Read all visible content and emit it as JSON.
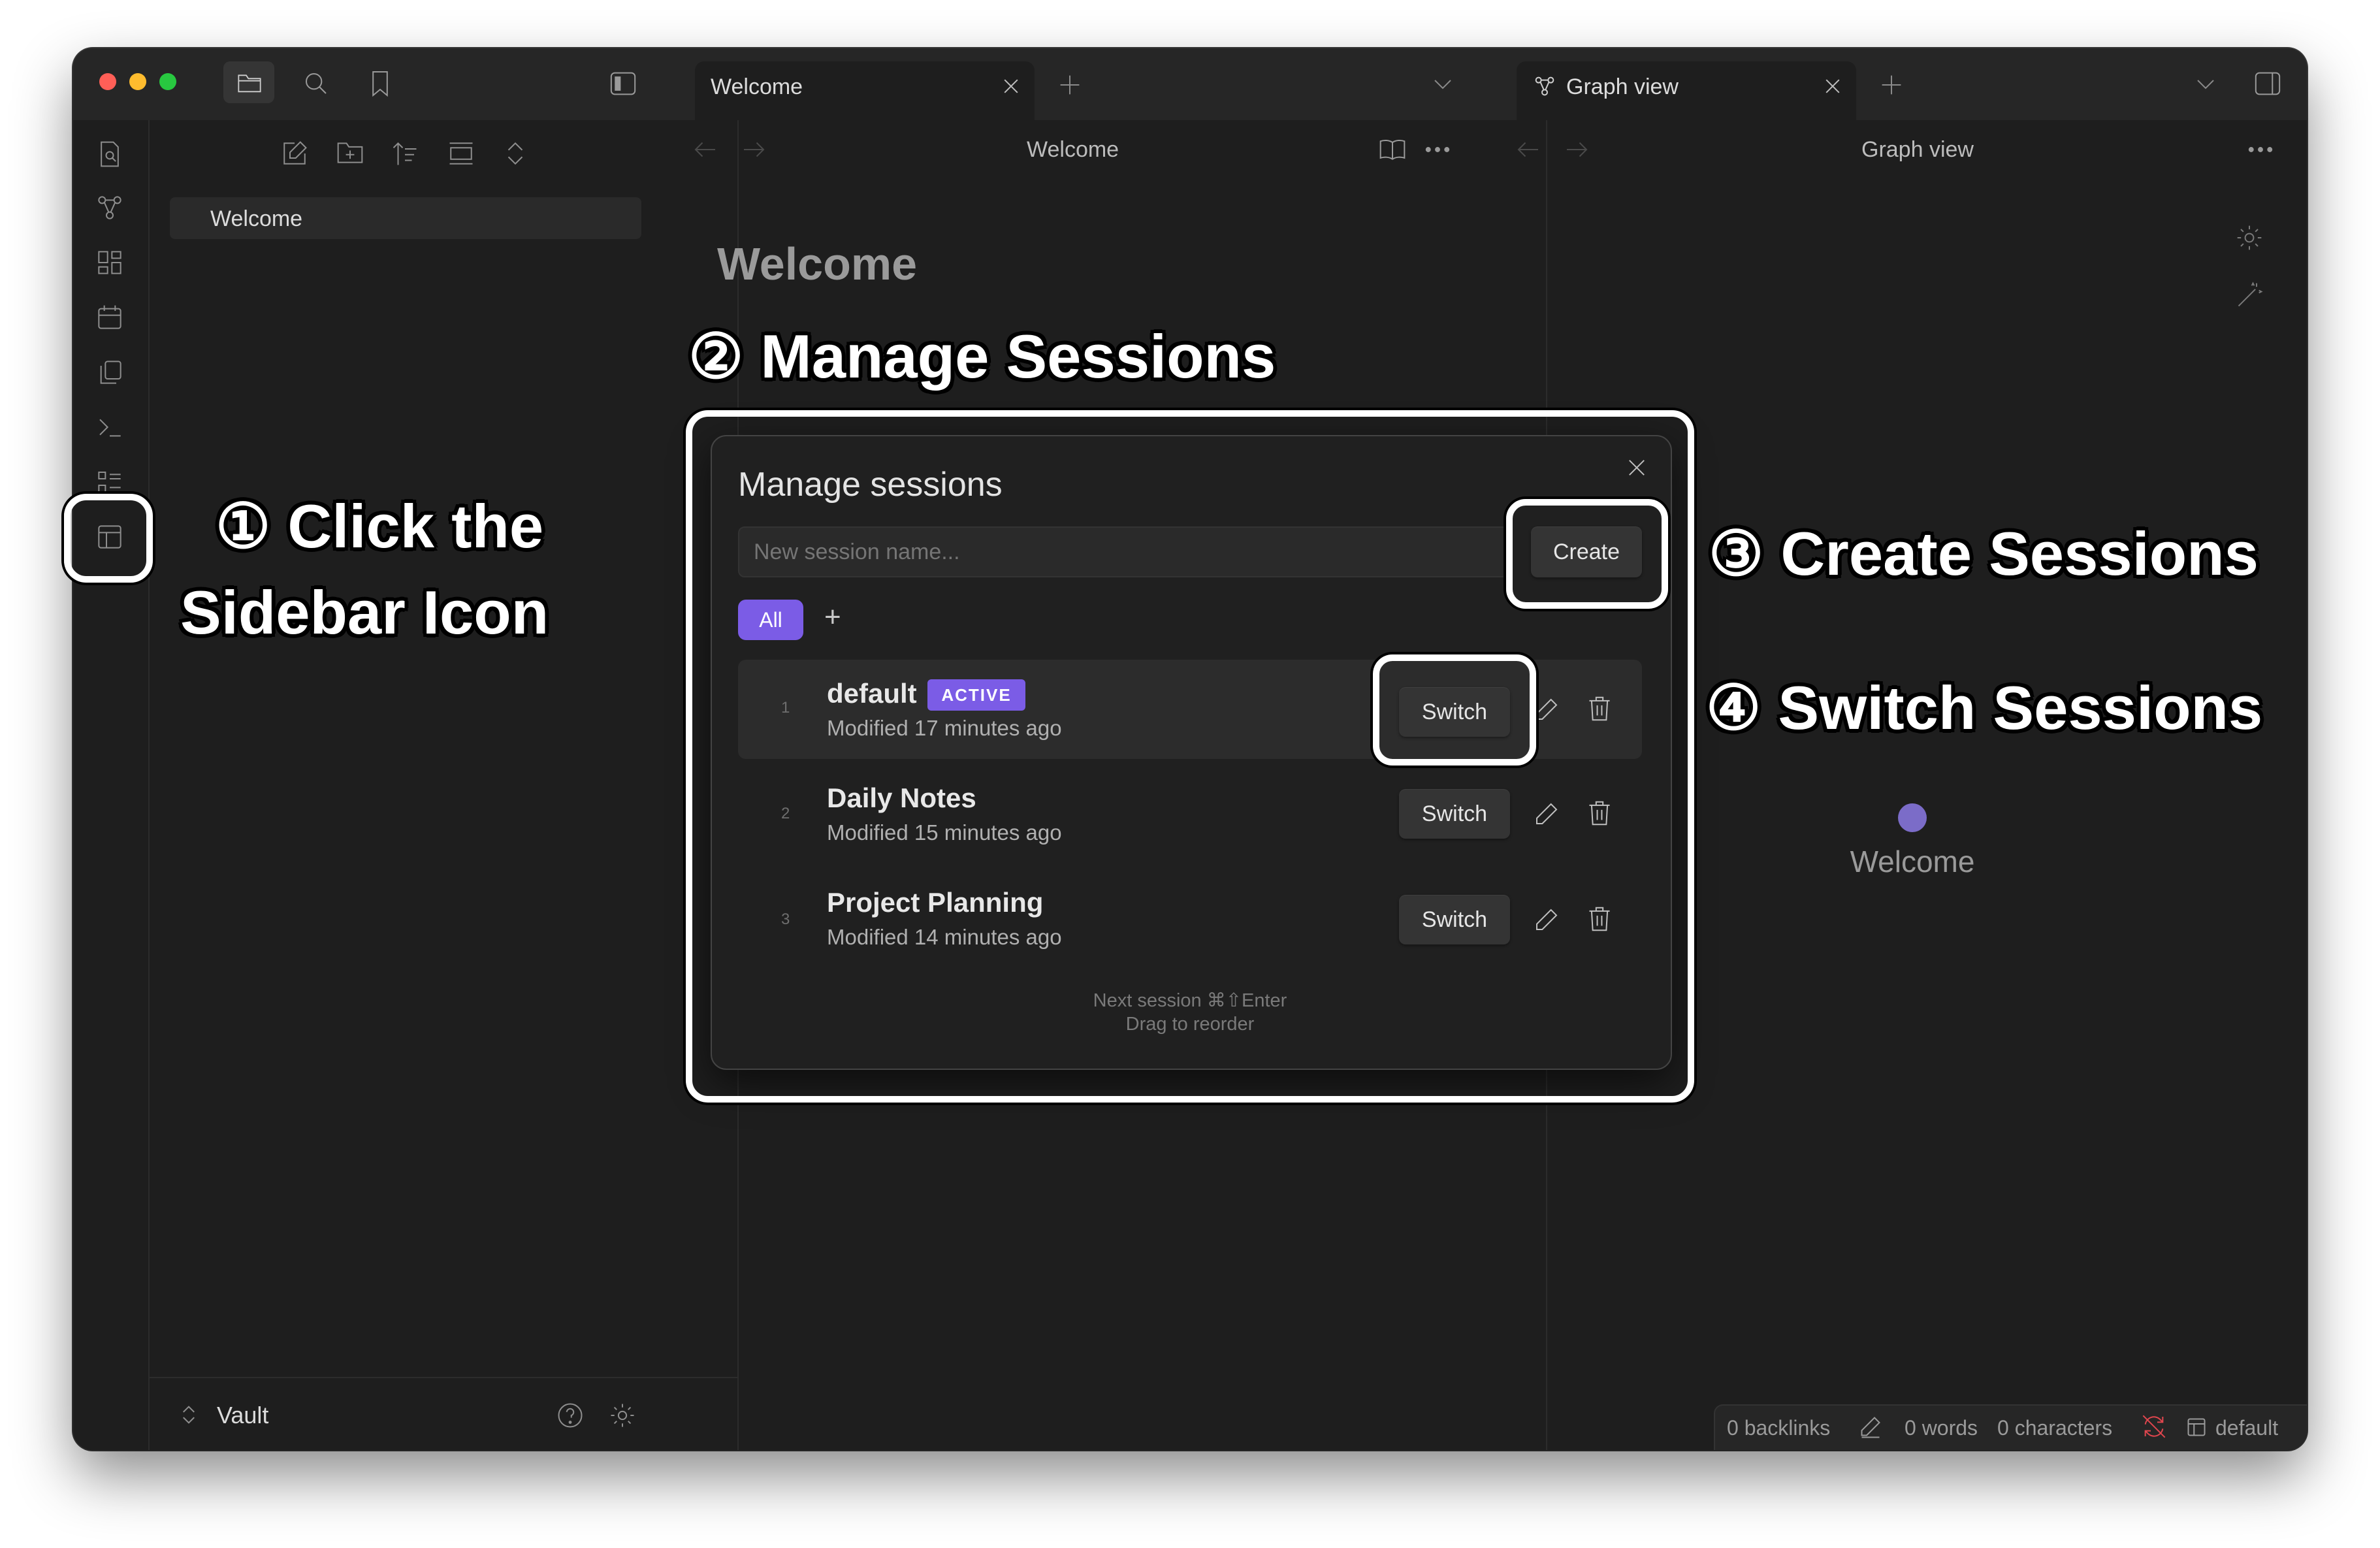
{
  "titlebar": {
    "tab_welcome": "Welcome",
    "tab_graph": "Graph view"
  },
  "sidebar": {
    "file_item": "Welcome",
    "vault_label": "Vault"
  },
  "left_pane": {
    "header_title": "Welcome",
    "doc_title": "Welcome"
  },
  "right_pane": {
    "header_title": "Graph view",
    "node_label": "Welcome",
    "node_color": "#7b6cc8"
  },
  "modal": {
    "title": "Manage sessions",
    "input_placeholder": "New session name...",
    "create_label": "Create",
    "filter_all": "All",
    "add_filter": "+",
    "sessions": [
      {
        "index": "1",
        "name": "default",
        "badge": "ACTIVE",
        "modified": "Modified 17 minutes ago",
        "switch_label": "Switch"
      },
      {
        "index": "2",
        "name": "Daily Notes",
        "modified": "Modified 15 minutes ago",
        "switch_label": "Switch"
      },
      {
        "index": "3",
        "name": "Project Planning",
        "modified": "Modified 14 minutes ago",
        "switch_label": "Switch"
      }
    ],
    "hint_next": "Next session ⌘⇧Enter",
    "hint_drag": "Drag to reorder"
  },
  "statusbar": {
    "backlinks": "0 backlinks",
    "words": "0 words",
    "characters": "0 characters",
    "session": "default"
  },
  "annotations": {
    "step1_line1": "① Click the",
    "step1_line2": "Sidebar Icon",
    "step2": "② Manage Sessions",
    "step3": "③ Create Sessions",
    "step4": "④ Switch Sessions"
  },
  "colors": {
    "accent": "#7b5ce6",
    "close": "#ff5f57",
    "minimize": "#febc2e",
    "zoom": "#28c840"
  }
}
